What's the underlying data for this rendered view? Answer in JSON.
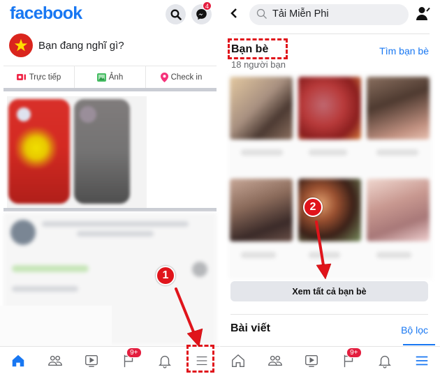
{
  "left_screen": {
    "header": {
      "logo": "facebook",
      "messenger_badge": "4"
    },
    "composer": {
      "placeholder": "Bạn đang nghĩ gì?"
    },
    "actions": [
      {
        "label": "Trực tiếp",
        "icon": "live-video-icon"
      },
      {
        "label": "Ảnh",
        "icon": "photo-icon"
      },
      {
        "label": "Check in",
        "icon": "location-pin-icon"
      }
    ],
    "tabbar": {
      "active": "home",
      "notifications_badge": "9+"
    }
  },
  "right_screen": {
    "search": {
      "value": "Tải Miễn Phi"
    },
    "friends": {
      "title": "Bạn bè",
      "find_link": "Tìm bạn bè",
      "count": "18 người bạn",
      "see_all": "Xem tất cả bạn bè"
    },
    "posts": {
      "title": "Bài viết",
      "filter_link": "Bộ lọc"
    },
    "tabbar": {
      "active": "menu",
      "notifications_badge": "9+"
    }
  },
  "annotations": {
    "step1": "1",
    "step2": "2"
  },
  "colors": {
    "brand_blue": "#1877f2",
    "annotation_red": "#e0141b",
    "badge_red": "#e41e3f"
  }
}
